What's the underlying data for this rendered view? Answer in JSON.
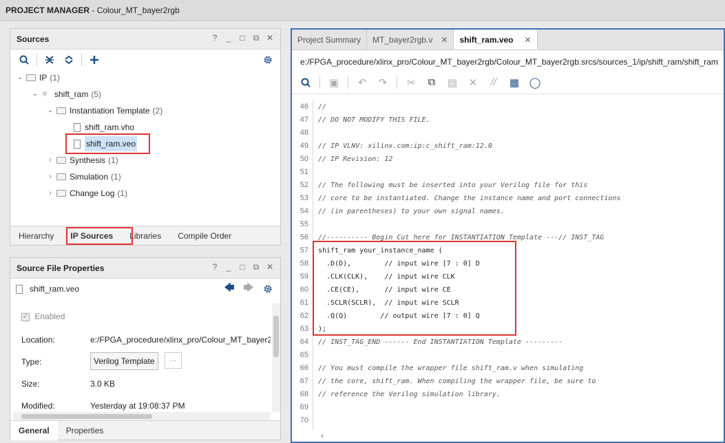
{
  "title": {
    "app": "PROJECT MANAGER",
    "sep": " - ",
    "project": "Colour_MT_bayer2rgb"
  },
  "sources": {
    "header": "Sources",
    "window_buttons": [
      "?",
      "_",
      "□",
      "⧉",
      "✕"
    ],
    "toolbar_icons": [
      "search-icon",
      "collapse-all-icon",
      "expand-all-icon",
      "add-icon",
      "gear-icon"
    ],
    "tree": {
      "ip": {
        "label": "IP",
        "count": "(1)"
      },
      "shift_ram": {
        "label": "shift_ram",
        "count": "(5)"
      },
      "inst": {
        "label": "Instantiation Template",
        "count": "(2)"
      },
      "vho": {
        "label": "shift_ram.vho"
      },
      "veo": {
        "label": "shift_ram.veo"
      },
      "synthesis": {
        "label": "Synthesis",
        "count": "(1)"
      },
      "simulation": {
        "label": "Simulation",
        "count": "(1)"
      },
      "changelog": {
        "label": "Change Log",
        "count": "(1)"
      }
    },
    "tabs": [
      "Hierarchy",
      "IP Sources",
      "Libraries",
      "Compile Order"
    ],
    "active_tab": "IP Sources"
  },
  "props": {
    "header": "Source File Properties",
    "file": "shift_ram.veo",
    "enabled_label": "Enabled",
    "location_label": "Location:",
    "location_value": "e:/FPGA_procedure/xlinx_pro/Colour_MT_bayer2",
    "type_label": "Type:",
    "type_value": "Verilog Template",
    "more_label": "...",
    "size_label": "Size:",
    "size_value": "3.0 KB",
    "modified_label": "Modified:",
    "modified_value": "Yesterday at 19:08:37 PM",
    "tabs": [
      "General",
      "Properties"
    ]
  },
  "editor": {
    "tabs": [
      "Project Summary",
      "MT_bayer2rgb.v",
      "shift_ram.veo"
    ],
    "active_tab": "shift_ram.veo",
    "path": "e:/FPGA_procedure/xlinx_pro/Colour_MT_bayer2rgb/Colour_MT_bayer2rgb.srcs/sources_1/ip/shift_ram/shift_ram",
    "lines": [
      {
        "n": "46",
        "t": "//"
      },
      {
        "n": "47",
        "t": "// DO NOT MODIFY THIS FILE."
      },
      {
        "n": "48",
        "t": ""
      },
      {
        "n": "49",
        "t": "// IP VLNV: xilinx.com:ip:c_shift_ram:12.0"
      },
      {
        "n": "50",
        "t": "// IP Revision: 12"
      },
      {
        "n": "51",
        "t": ""
      },
      {
        "n": "52",
        "t": "// The following must be inserted into your Verilog file for this"
      },
      {
        "n": "53",
        "t": "// core to be instantiated. Change the instance name and port connections"
      },
      {
        "n": "54",
        "t": "// (in parentheses) to your own signal names."
      },
      {
        "n": "55",
        "t": ""
      },
      {
        "n": "56",
        "t": "//---------- Begin Cut here for INSTANTIATION Template ---// INST_TAG"
      },
      {
        "n": "57",
        "t": "shift_ram your_instance_name ("
      },
      {
        "n": "58",
        "t": "  .D(D),        // input wire [7 : 0] D"
      },
      {
        "n": "59",
        "t": "  .CLK(CLK),    // input wire CLK"
      },
      {
        "n": "60",
        "t": "  .CE(CE),      // input wire CE"
      },
      {
        "n": "61",
        "t": "  .SCLR(SCLR),  // input wire SCLR"
      },
      {
        "n": "62",
        "t": "  .Q(Q)        // output wire [7 : 0] Q"
      },
      {
        "n": "63",
        "t": ");"
      },
      {
        "n": "64",
        "t": "// INST_TAG_END ------ End INSTANTIATION Template ---------"
      },
      {
        "n": "65",
        "t": ""
      },
      {
        "n": "66",
        "t": "// You must compile the wrapper file shift_ram.v when simulating"
      },
      {
        "n": "67",
        "t": "// the core, shift_ram. When compiling the wrapper file, be sure to"
      },
      {
        "n": "68",
        "t": "// reference the Verilog simulation library."
      },
      {
        "n": "69",
        "t": ""
      },
      {
        "n": "70",
        "t": ""
      }
    ]
  }
}
